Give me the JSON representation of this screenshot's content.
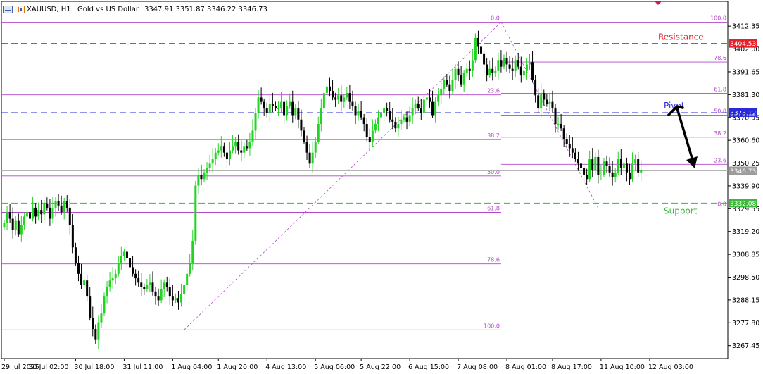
{
  "header": {
    "symbol": "XAUUSD, H1:",
    "description": "Gold vs US Dollar",
    "ohlc": "3347.91 3351.87 3346.22 3346.73"
  },
  "chart_data": {
    "type": "candlestick",
    "y_axis": {
      "ylim": [
        3261.6,
        3417.2
      ],
      "ticks": [
        "3412.35",
        "3402.00",
        "3391.65",
        "3381.30",
        "3370.95",
        "3360.60",
        "3350.25",
        "3339.90",
        "3329.55",
        "3319.20",
        "3308.85",
        "3298.50",
        "3288.15",
        "3277.80",
        "3267.45"
      ]
    },
    "x_axis": {
      "ticks": [
        {
          "label": "29 Jul 2025",
          "index": 0
        },
        {
          "label": "30 Jul 02:00",
          "index": 9
        },
        {
          "label": "30 Jul 18:00",
          "index": 25
        },
        {
          "label": "31 Jul 11:00",
          "index": 42
        },
        {
          "label": "1 Aug 04:00",
          "index": 59
        },
        {
          "label": "1 Aug 20:00",
          "index": 75
        },
        {
          "label": "4 Aug 13:00",
          "index": 92
        },
        {
          "label": "5 Aug 06:00",
          "index": 109
        },
        {
          "label": "5 Aug 22:00",
          "index": 125
        },
        {
          "label": "6 Aug 15:00",
          "index": 142
        },
        {
          "label": "7 Aug 08:00",
          "index": 159
        },
        {
          "label": "8 Aug 01:00",
          "index": 176
        },
        {
          "label": "8 Aug 17:00",
          "index": 192
        },
        {
          "label": "11 Aug 10:00",
          "index": 209
        },
        {
          "label": "12 Aug 03:00",
          "index": 226
        }
      ]
    },
    "closes": [
      3323,
      3328,
      3325,
      3320,
      3324,
      3318,
      3322,
      3326,
      3328,
      3325,
      3330,
      3326,
      3329,
      3327,
      3332,
      3330,
      3325,
      3330,
      3333,
      3331,
      3328,
      3333,
      3330,
      3322,
      3312,
      3305,
      3300,
      3295,
      3297,
      3290,
      3280,
      3275,
      3270,
      3278,
      3282,
      3290,
      3294,
      3297,
      3298,
      3300,
      3305,
      3308,
      3310,
      3307,
      3303,
      3300,
      3298,
      3296,
      3294,
      3293,
      3295,
      3296,
      3292,
      3290,
      3288,
      3293,
      3296,
      3294,
      3290,
      3288,
      3289,
      3287,
      3291,
      3295,
      3300,
      3305,
      3315,
      3340,
      3345,
      3343,
      3346,
      3348,
      3350,
      3352,
      3355,
      3356,
      3358,
      3355,
      3352,
      3356,
      3358,
      3360,
      3356,
      3355,
      3358,
      3357,
      3360,
      3365,
      3373,
      3380,
      3378,
      3375,
      3373,
      3377,
      3376,
      3375,
      3375,
      3378,
      3372,
      3376,
      3378,
      3372,
      3375,
      3370,
      3365,
      3360,
      3355,
      3350,
      3355,
      3360,
      3368,
      3375,
      3382,
      3385,
      3383,
      3380,
      3379,
      3381,
      3378,
      3380,
      3382,
      3378,
      3376,
      3372,
      3374,
      3371,
      3368,
      3362,
      3360,
      3365,
      3368,
      3371,
      3373,
      3375,
      3374,
      3370,
      3369,
      3366,
      3368,
      3370,
      3371,
      3369,
      3372,
      3375,
      3377,
      3375,
      3373,
      3379,
      3380,
      3378,
      3372,
      3378,
      3381,
      3384,
      3388,
      3386,
      3383,
      3388,
      3393,
      3390,
      3386,
      3391,
      3393,
      3392,
      3397,
      3407,
      3403,
      3400,
      3395,
      3390,
      3393,
      3391,
      3392,
      3397,
      3394,
      3398,
      3395,
      3393,
      3392,
      3397,
      3394,
      3390,
      3392,
      3395,
      3396,
      3388,
      3381,
      3375,
      3382,
      3379,
      3377,
      3378,
      3375,
      3368,
      3368,
      3366,
      3361,
      3359,
      3357,
      3355,
      3352,
      3350,
      3348,
      3345,
      3343,
      3352,
      3347,
      3353,
      3345,
      3345,
      3351,
      3349,
      3346,
      3344,
      3346,
      3352,
      3348,
      3350,
      3346,
      3343,
      3350,
      3352,
      3346,
      3347
    ],
    "fibonacci_left": {
      "levels": [
        {
          "label": "0.0",
          "price": 3414.2
        },
        {
          "label": "23.6",
          "price": 3381.2
        },
        {
          "label": "38.2",
          "price": 3360.9
        },
        {
          "label": "50.0",
          "price": 3344.4
        },
        {
          "label": "61.8",
          "price": 3327.9
        },
        {
          "label": "78.6",
          "price": 3304.5
        },
        {
          "label": "100.0",
          "price": 3274.6
        }
      ]
    },
    "fibonacci_right": {
      "levels": [
        {
          "label": "100.0",
          "price": 3414.2
        },
        {
          "label": "78.6",
          "price": 3396.1
        },
        {
          "label": "61.8",
          "price": 3381.9
        },
        {
          "label": "50.0",
          "price": 3372.0
        },
        {
          "label": "38.2",
          "price": 3362.0
        },
        {
          "label": "23.6",
          "price": 3349.7
        },
        {
          "label": "0.0",
          "price": 3329.8
        }
      ]
    },
    "horizontal_lines": [
      {
        "name": "Resistance",
        "price": 3404.53,
        "price_label": "3404.53",
        "color": "#e8202a"
      },
      {
        "name": "Pivot",
        "price": 3373.12,
        "price_label": "3373.12",
        "color": "#2a2ad8"
      },
      {
        "name": "Support",
        "price": 3332.08,
        "price_label": "3332.08",
        "color": "#3cb83c"
      }
    ],
    "current_price": {
      "price": 3346.73,
      "label": "3346.73"
    },
    "annotations": [
      "Resistance",
      "Pivot",
      "Support"
    ],
    "colors": {
      "bull": "#22d422",
      "bear": "#000000",
      "fib": "#b048c8",
      "current": "#a9a9a9"
    }
  }
}
